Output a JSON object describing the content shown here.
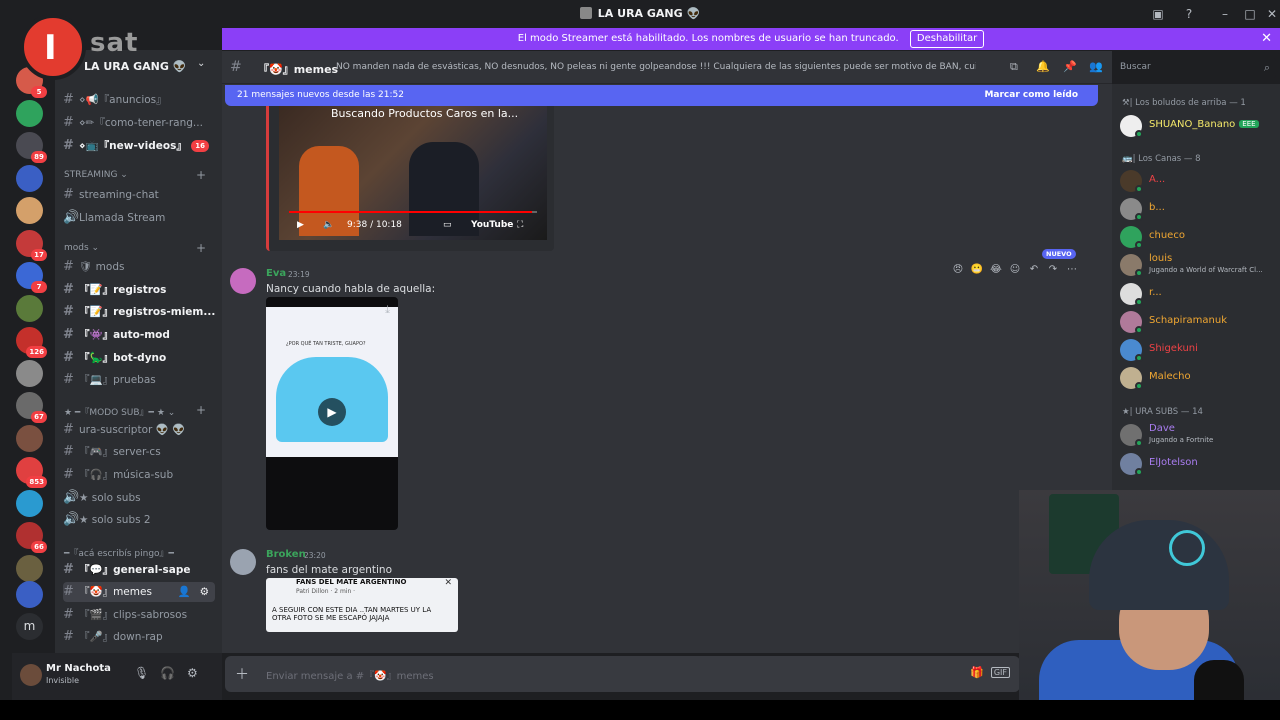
{
  "window": {
    "title": "LA URA GANG 👽"
  },
  "banner": {
    "text": "El modo Streamer está habilitado. Los nombres de usuario se han truncado.",
    "button": "Deshabilitar"
  },
  "servers": [
    {
      "badge": "5"
    },
    {
      "badge": ""
    },
    {
      "badge": "89"
    },
    {
      "badge": ""
    },
    {
      "badge": ""
    },
    {
      "badge": "17"
    },
    {
      "badge": "7"
    },
    {
      "badge": ""
    },
    {
      "badge": "126"
    },
    {
      "badge": ""
    },
    {
      "badge": "67"
    },
    {
      "badge": ""
    },
    {
      "badge": "853"
    },
    {
      "badge": ""
    },
    {
      "badge": "66"
    },
    {
      "badge": ""
    },
    {
      "badge": ""
    },
    {
      "letter": "m"
    }
  ],
  "guild": {
    "name": "LA URA GANG 👽"
  },
  "logo": {
    "mark": "I",
    "text": "sat"
  },
  "channels": {
    "anuncios": "⋄📢『anuncios』",
    "como": "⋄✏『como-tener-rang...",
    "newvideos": "⋄📺『new-videos』",
    "newvideos_badge": "16",
    "cat_streaming": "STREAMING ⌄",
    "streaming_chat": "streaming-chat",
    "llamada": "Llamada Stream",
    "cat_mods": "mods ⌄",
    "mods": "🛡 mods",
    "registros": "『📝』registros",
    "registros_miem": "『📝』registros-miem...",
    "automod": "『👾』auto-mod",
    "botdyno": "『🦕』bot-dyno",
    "pruebas": "『💻』pruebas",
    "cat_sub": "★ ━『MODO SUB』━ ★ ⌄",
    "ura_suscriptor": "ura-suscriptor 👽 👽",
    "server_cs": "『🎮』server-cs",
    "musica_sub": "『🎧』música-sub",
    "solo_subs": "★ solo subs",
    "solo_subs2": "★ solo subs 2",
    "cat_aca": "━『acá escribís pingo』━",
    "general_sape": "『💬』general-sape",
    "memes": "『🤡』memes",
    "clips": "『🎬』clips-sabrosos",
    "down_rap": "『🎤』down-rap"
  },
  "user": {
    "name": "Mr Nachota",
    "status": "Invisible"
  },
  "topbar": {
    "channel": "『🤡』memes",
    "topic": "NO manden nada de esvásticas, NO desnudos, NO peleas ni gente golpeandose !!! Cualquiera de las siguientes puede ser motivo de BAN, cuiden el stream!"
  },
  "search": {
    "placeholder": "Buscar"
  },
  "newmsg": {
    "text": "21 mensajes nuevos desde las 21:52",
    "mark": "Marcar como leído"
  },
  "youtube": {
    "title": "Buscando Productos Caros en la...",
    "time": "9:38 / 10:18",
    "brand": "YouTube"
  },
  "messages": [
    {
      "author": "Eva",
      "time": "23:19",
      "text": "Nancy cuando habla de aquella:"
    },
    {
      "author": "Broken",
      "time": "23:20",
      "text": "fans del mate argentino"
    }
  ],
  "video": {
    "caption": "¿POR QUÉ TAN TRISTE, GUAPO?",
    "progress": 0.98
  },
  "badge_new": "NUEVO",
  "fbpost": {
    "header": "FANS DEL MATE ARGENTINO",
    "author": "Patri Dillon · 2 min ·",
    "body": "A SEGUIR CON ESTE DIA ..TAN MARTES UY LA OTRA FOTO SE ME ESCAPÓ JAJAJA"
  },
  "composer": {
    "placeholder": "Enviar mensaje a #『🤡』memes"
  },
  "members": {
    "cat1": "⚒| Los boludos de arriba — 1",
    "cat2": "🚌| Los Canas — 8",
    "cat3": "★| URA SUBS — 14",
    "list1": [
      {
        "name": "SHUANO_Banano",
        "tag": "EEE",
        "color": "#f5e96a"
      }
    ],
    "list2": [
      {
        "name": "A...",
        "color": "#ed4245"
      },
      {
        "name": "b...",
        "color": "#f0a732"
      },
      {
        "name": "chueco",
        "color": "#f0a732"
      },
      {
        "name": "louis",
        "color": "#f0a732",
        "activity": "Jugando a World of Warcraft Cl..."
      },
      {
        "name": "r...",
        "color": "#f0a732"
      },
      {
        "name": "Schapiramanuk",
        "color": "#f0a732"
      },
      {
        "name": "Shigekuni",
        "color": "#ed4245"
      },
      {
        "name": "Malecho",
        "color": "#f0a732"
      }
    ],
    "list3": [
      {
        "name": "Dave",
        "color": "#a97df0",
        "activity": "Jugando a Fortnite"
      },
      {
        "name": "ElJotelson",
        "color": "#a97df0"
      }
    ]
  },
  "colors": {
    "accent": "#5865f2",
    "streamer": "#8b3ff7",
    "online": "#23a55a",
    "author_green": "#3ba55c"
  }
}
